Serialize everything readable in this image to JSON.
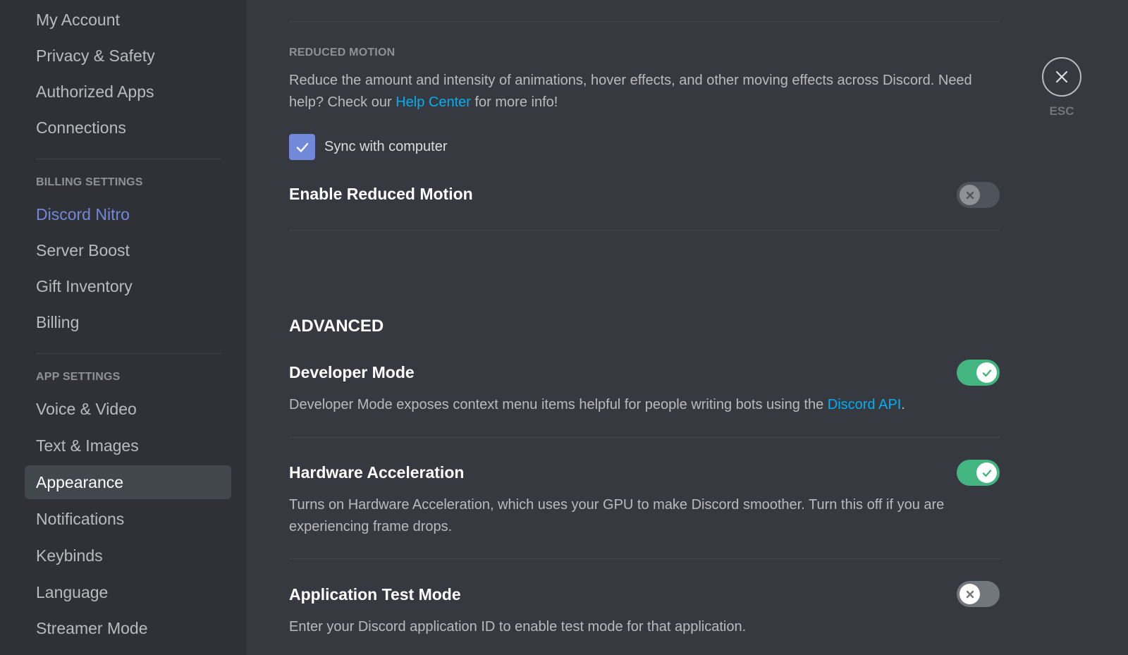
{
  "sidebar": {
    "user_items": [
      {
        "label": "My Account"
      },
      {
        "label": "Privacy & Safety"
      },
      {
        "label": "Authorized Apps"
      },
      {
        "label": "Connections"
      }
    ],
    "billing_header": "BILLING SETTINGS",
    "billing_items": [
      {
        "label": "Discord Nitro"
      },
      {
        "label": "Server Boost"
      },
      {
        "label": "Gift Inventory"
      },
      {
        "label": "Billing"
      }
    ],
    "app_header": "APP SETTINGS",
    "app_items": [
      {
        "label": "Voice & Video"
      },
      {
        "label": "Text & Images"
      },
      {
        "label": "Appearance"
      },
      {
        "label": "Notifications"
      },
      {
        "label": "Keybinds"
      },
      {
        "label": "Language"
      },
      {
        "label": "Streamer Mode"
      }
    ],
    "selected_item": "Appearance"
  },
  "reduced_motion": {
    "header": "REDUCED MOTION",
    "desc_part1": "Reduce the amount and intensity of animations, hover effects, and other moving effects across Discord. Need help? Check our ",
    "help_link": "Help Center",
    "desc_part2": " for more info!",
    "sync_label": "Sync with computer",
    "sync_checked": true,
    "enable_label": "Enable Reduced Motion",
    "enable_state": "off-disabled"
  },
  "advanced": {
    "header": "ADVANCED",
    "developer_mode": {
      "title": "Developer Mode",
      "desc": "Developer Mode exposes context menu items helpful for people writing bots using the ",
      "link": "Discord API",
      "desc_end": ".",
      "enabled": true
    },
    "hardware_acceleration": {
      "title": "Hardware Acceleration",
      "desc": "Turns on Hardware Acceleration, which uses your GPU to make Discord smoother. Turn this off if you are experiencing frame drops.",
      "enabled": true
    },
    "app_test_mode": {
      "title": "Application Test Mode",
      "desc": "Enter your Discord application ID to enable test mode for that application.",
      "enabled": false
    }
  },
  "close": {
    "label": "ESC"
  },
  "colors": {
    "sidebar_bg": "#2f3136",
    "content_bg": "#36393f",
    "accent": "#7289da",
    "toggle_on": "#43b581",
    "toggle_off": "#72767d",
    "link": "#00aff4"
  }
}
